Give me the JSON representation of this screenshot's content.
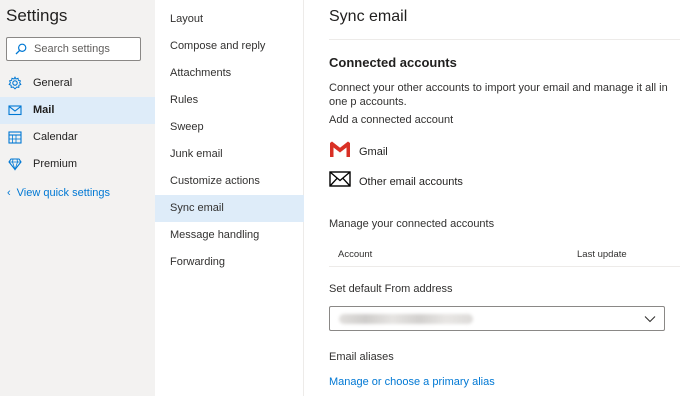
{
  "settings": {
    "title": "Settings",
    "search_placeholder": "Search settings",
    "nav": [
      {
        "label": "General",
        "icon": "gear-icon",
        "active": false
      },
      {
        "label": "Mail",
        "icon": "mail-icon",
        "active": true
      },
      {
        "label": "Calendar",
        "icon": "calendar-icon",
        "active": false
      },
      {
        "label": "Premium",
        "icon": "diamond-icon",
        "active": false
      }
    ],
    "quick_settings_label": "View quick settings"
  },
  "mail_menu": [
    {
      "label": "Layout",
      "active": false
    },
    {
      "label": "Compose and reply",
      "active": false
    },
    {
      "label": "Attachments",
      "active": false
    },
    {
      "label": "Rules",
      "active": false
    },
    {
      "label": "Sweep",
      "active": false
    },
    {
      "label": "Junk email",
      "active": false
    },
    {
      "label": "Customize actions",
      "active": false
    },
    {
      "label": "Sync email",
      "active": true
    },
    {
      "label": "Message handling",
      "active": false
    },
    {
      "label": "Forwarding",
      "active": false
    }
  ],
  "main": {
    "title": "Sync email",
    "connected_heading": "Connected accounts",
    "description": "Connect your other accounts to import your email and manage it all in one p accounts.",
    "add_label": "Add a connected account",
    "accounts": [
      {
        "label": "Gmail",
        "icon": "gmail-icon"
      },
      {
        "label": "Other email accounts",
        "icon": "envelope-icon"
      }
    ],
    "manage_label": "Manage your connected accounts",
    "table_headers": {
      "account": "Account",
      "last_update": "Last update"
    },
    "from_label": "Set default From address",
    "aliases_label": "Email aliases",
    "alias_link": "Manage or choose a primary alias"
  },
  "colors": {
    "accent": "#0078d4",
    "selected_bg": "#deecf9",
    "sidebar_bg": "#f3f2f1",
    "gmail_red": "#d93025"
  }
}
